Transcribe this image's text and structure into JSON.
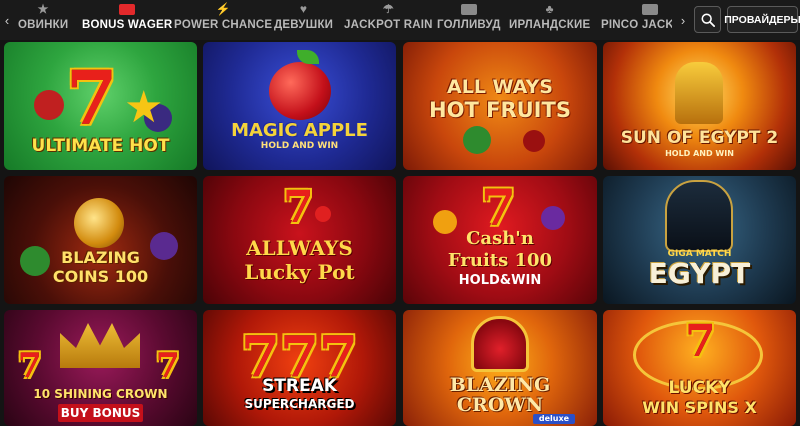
{
  "categories": [
    {
      "label": "ОВИНКИ",
      "icon": "star-icon"
    },
    {
      "label": "BONUS WAGER",
      "icon": "gift-icon"
    },
    {
      "label": "POWER CHANCE",
      "icon": "bolt-icon"
    },
    {
      "label": "ДЕВУШКИ",
      "icon": "heart-icon"
    },
    {
      "label": "JACKPOT RAIN",
      "icon": "rain-icon"
    },
    {
      "label": "ГОЛЛИВУД",
      "icon": "camera-icon"
    },
    {
      "label": "ИРЛАНДСКИЕ",
      "icon": "clover-icon"
    },
    {
      "label": "PINCO JACKPOT",
      "icon": "slot-icon"
    }
  ],
  "active_category": "BONUS WAGER",
  "nav": {
    "prev": "‹",
    "next": "›"
  },
  "search": {
    "icon": "search-icon"
  },
  "providers_label": "ПРОВАЙДЕРЫ",
  "games": [
    {
      "name_line1": "ULTIMATE HOT",
      "name_line2": ""
    },
    {
      "name_line1": "MAGIC APPLE",
      "name_line2": "HOLD AND WIN"
    },
    {
      "name_line1": "ALL WAYS",
      "name_line2": "HOT FRUITS"
    },
    {
      "name_line1": "SUN OF EGYPT 2",
      "name_line2": "HOLD AND WIN"
    },
    {
      "name_line1": "BLAZING",
      "name_line2": "COINS 100"
    },
    {
      "name_line1": "ALLWAYS",
      "name_line2": "Lucky Pot"
    },
    {
      "name_line1": "Cash'n",
      "name_line2": "Fruits 100",
      "name_line3": "HOLD&WIN"
    },
    {
      "name_line1": "GIGA MATCH",
      "name_line2": "EGYPT"
    },
    {
      "name_line1": "10 SHINING CROWN",
      "name_line2": "BUY BONUS"
    },
    {
      "name_line1": "STREAK",
      "name_line2": "SUPERCHARGED"
    },
    {
      "name_line1": "BLAZING",
      "name_line2": "CROWN",
      "name_line3": "deluxe"
    },
    {
      "name_line1": "LUCKY",
      "name_line2": "WIN SPINS X"
    }
  ],
  "colors": {
    "accent": "#e3292b",
    "bar_bg": "#1a1a1a",
    "page_bg": "#141414"
  }
}
